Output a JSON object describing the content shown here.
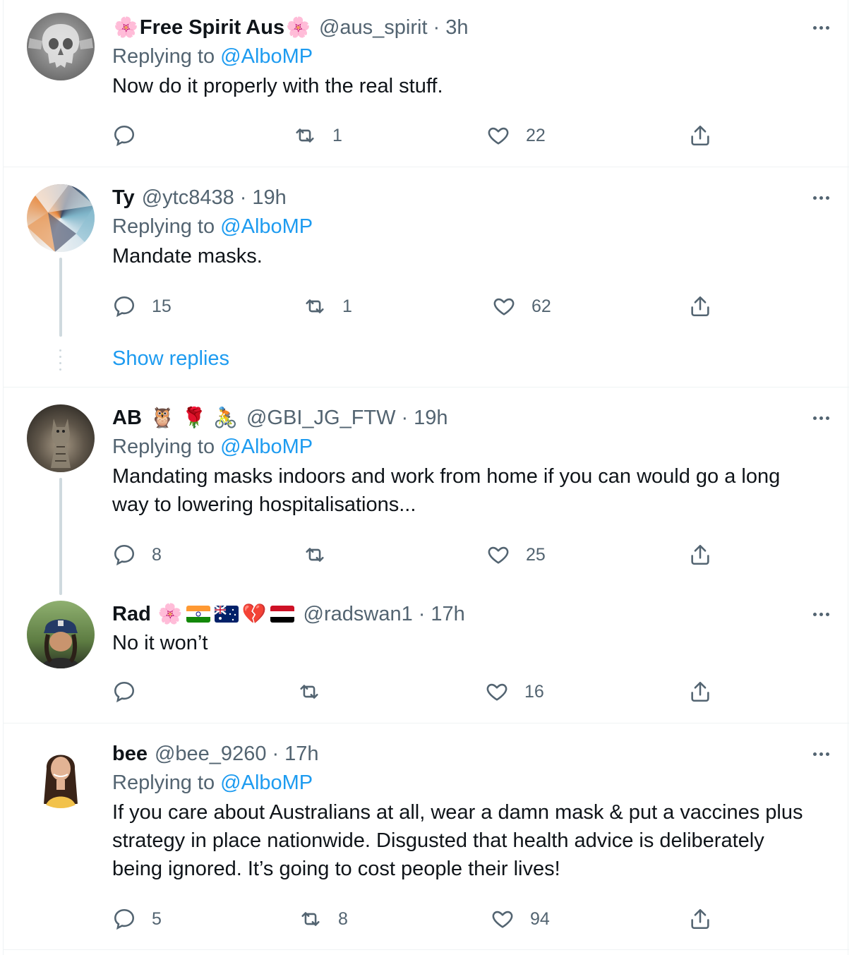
{
  "tweets": [
    {
      "name": "Free Spirit Aus",
      "name_prefix_emoji": "🌸",
      "name_suffix_emoji": "🌸",
      "handle": "@aus_spirit",
      "separator": "·",
      "time": "3h",
      "replying_prefix": "Replying to ",
      "replying_to": "@AlboMP",
      "text": "Now do it properly with the real stuff.",
      "replies": "",
      "retweets": "1",
      "likes": "22"
    },
    {
      "name": "Ty",
      "handle": "@ytc8438",
      "separator": "·",
      "time": "19h",
      "replying_prefix": "Replying to ",
      "replying_to": "@AlboMP",
      "text": "Mandate masks.",
      "replies": "15",
      "retweets": "1",
      "likes": "62",
      "show_replies": "Show replies"
    },
    {
      "name": "AB",
      "name_emojis": "🦉 🌹 🚴",
      "handle": "@GBI_JG_FTW",
      "separator": "·",
      "time": "19h",
      "replying_prefix": "Replying to ",
      "replying_to": "@AlboMP",
      "text_line1": "Mandating masks indoors and work from home if you can would go a long",
      "text_line2": "way to lowering hospitalisations...",
      "replies": "8",
      "retweets": "",
      "likes": "25"
    },
    {
      "name": "Rad",
      "name_emoji_flower": "🌸",
      "name_emoji_heart": "💔",
      "handle": "@radswan1",
      "separator": "·",
      "time": "17h",
      "text": "No it won’t",
      "replies": "",
      "retweets": "",
      "likes": "16"
    },
    {
      "name": "bee",
      "handle": "@bee_9260",
      "separator": "·",
      "time": "17h",
      "replying_prefix": "Replying to ",
      "replying_to": "@AlboMP",
      "text_line1": "If you care about Australians at all, wear a damn mask & put a vaccines plus",
      "text_line2": "strategy in place nationwide. Disgusted that health advice is deliberately",
      "text_line3": "being ignored. It’s going to cost people their lives!",
      "replies": "5",
      "retweets": "8",
      "likes": "94"
    }
  ],
  "colors": {
    "link": "#1d9bf0",
    "secondary_text": "#536471",
    "primary_text": "#0f1419",
    "thread_line": "#cfd9de",
    "divider": "#eff3f4"
  }
}
